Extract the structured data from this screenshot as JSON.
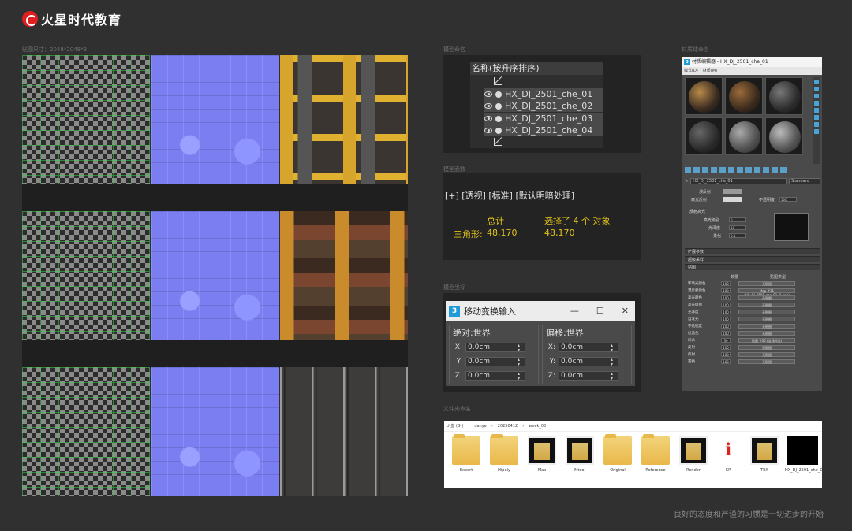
{
  "brand": {
    "name": "火星时代教育"
  },
  "labels": {
    "texture_size": "贴图尺寸：2048*2048*3",
    "outliner": "模型命名",
    "stats": "模型面数",
    "coords": "模型坐标",
    "materials": "材质球命名",
    "files": "文件夹命名"
  },
  "outliner": {
    "header": "名称(按升序排序)",
    "items": [
      "HX_DJ_2501_che_01",
      "HX_DJ_2501_che_02",
      "HX_DJ_2501_che_03",
      "HX_DJ_2501_che_04"
    ]
  },
  "stats": {
    "toolbar": "[+] [透视] [标准] [默认明暗处理]",
    "total_label": "总计",
    "selected_label": "选择了 4 个 对象",
    "tri_label": "三角形:",
    "total_value": "48,170",
    "selected_value": "48,170"
  },
  "transform": {
    "title": "移动变换输入",
    "minimize": "—",
    "maximize": "☐",
    "close": "✕",
    "absolute_title": "绝对:世界",
    "offset_title": "偏移:世界",
    "axes": [
      "X:",
      "Y:",
      "Z:"
    ],
    "absolute_values": [
      "0.0cm",
      "0.0cm",
      "0.0cm"
    ],
    "offset_values": [
      "0.0cm",
      "0.0cm",
      "0.0cm"
    ]
  },
  "material_editor": {
    "title": "材质编辑器 - HX_DJ_2501_che_01",
    "menu": [
      "模式(D)",
      "材质(M)"
    ],
    "material_name": "HX_DJ_2501_che_01",
    "material_type": "Standard",
    "diffuse_label": "漫反射",
    "specular_label": "高光反射",
    "opacity_label": "不透明度",
    "opacity_value": "100",
    "highlight_section": "反射高光",
    "spec_level": "高光级别",
    "glossiness": "光泽度",
    "soften": "柔化",
    "spec_level_value": "0",
    "glossiness_value": "10",
    "soften_value": "0.1",
    "rollout_extended": "扩展参数",
    "rollout_supersampling": "超级采样",
    "rollout_maps": "贴图",
    "map_amount_header": "数量",
    "map_type_header": "贴图类型",
    "maps": [
      {
        "name": "环境光颜色",
        "amount": "100",
        "map": "无贴图"
      },
      {
        "name": "漫反射颜色",
        "amount": "100",
        "map": "Map #31 (HX_DJ_2501_che_01_D.png)"
      },
      {
        "name": "高光颜色",
        "amount": "100",
        "map": "无贴图"
      },
      {
        "name": "高光级别",
        "amount": "100",
        "map": "无贴图"
      },
      {
        "name": "光泽度",
        "amount": "100",
        "map": "无贴图"
      },
      {
        "name": "自发光",
        "amount": "100",
        "map": "无贴图"
      },
      {
        "name": "不透明度",
        "amount": "100",
        "map": "无贴图"
      },
      {
        "name": "过滤色",
        "amount": "100",
        "map": "无贴图"
      },
      {
        "name": "凹凸",
        "amount": "30",
        "map": "贴图 #35 (法线凹凸)"
      },
      {
        "name": "反射",
        "amount": "100",
        "map": "无贴图"
      },
      {
        "name": "折射",
        "amount": "100",
        "map": "无贴图"
      },
      {
        "name": "置换",
        "amount": "100",
        "map": "无贴图"
      }
    ]
  },
  "explorer": {
    "path": [
      "U 盘 (G:)",
      "danye",
      "20250412",
      "week_03"
    ],
    "folders": [
      "Export",
      "Hipoly",
      "Max",
      "Mtool",
      "Original",
      "Reference",
      "Render",
      "SP",
      "TEX",
      "HX_DJ_2501_che_D"
    ]
  },
  "motto": "良好的态度和严谨的习惯是一切进步的开始"
}
